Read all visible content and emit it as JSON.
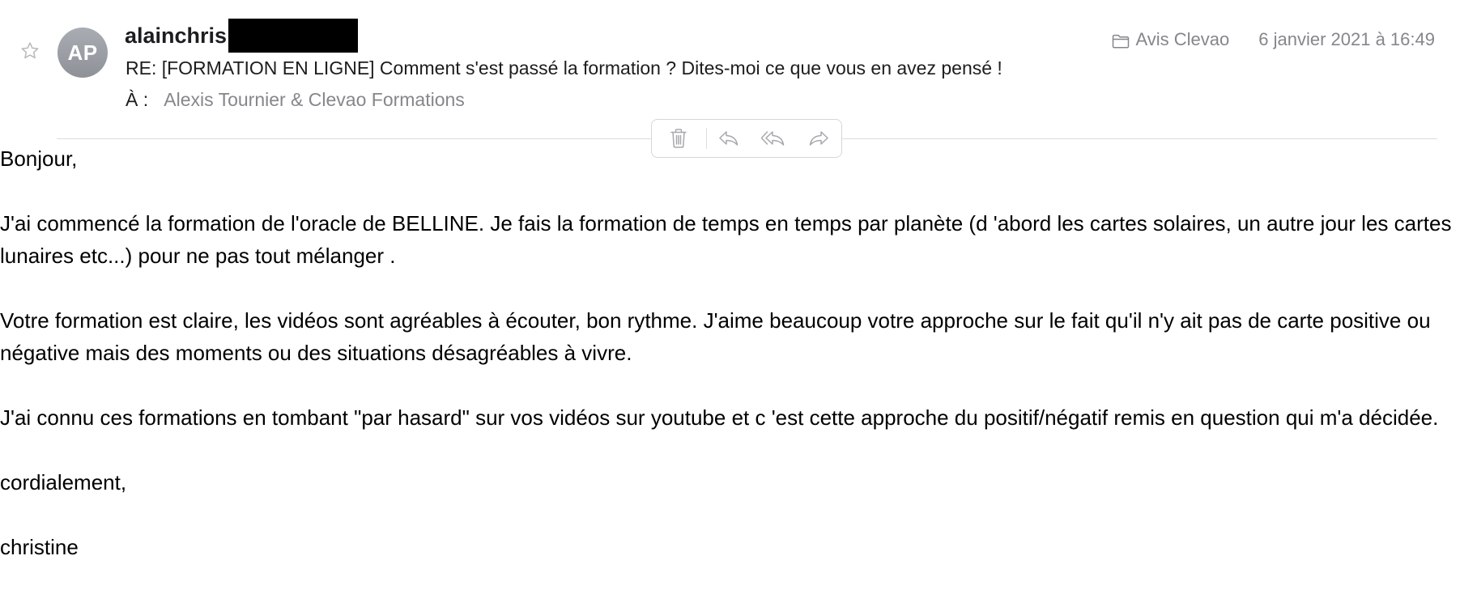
{
  "header": {
    "avatar_initials": "AP",
    "sender_name": "alainchris",
    "subject": "RE: [FORMATION EN LIGNE] Comment s'est passé la formation ? Dites-moi ce que vous en avez pensé !",
    "to_label": "À :",
    "to_value": "Alexis Tournier & Clevao Formations",
    "mailbox": "Avis Clevao",
    "date": "6 janvier 2021 à 16:49"
  },
  "toolbar": {
    "icons": [
      "trash-icon",
      "reply-icon",
      "reply-all-icon",
      "forward-icon"
    ]
  },
  "message": {
    "greeting": "Bonjour,",
    "paragraph_1": "J'ai commencé la formation de l'oracle de BELLINE. Je fais la formation de temps en temps par planète (d 'abord les cartes solaires, un autre jour les cartes lunaires etc...) pour ne pas tout mélanger .",
    "paragraph_2": "Votre formation est claire, les vidéos sont agréables à écouter, bon rythme. J'aime beaucoup votre approche sur le fait qu'il n'y ait pas de carte positive ou négative mais des moments ou des situations désagréables à vivre.",
    "paragraph_3": "J'ai connu ces formations en tombant \"par hasard\" sur vos vidéos sur youtube et c 'est cette approche du positif/négatif remis en question qui m'a décidée.",
    "closing": "cordialement,",
    "signature": "christine"
  }
}
